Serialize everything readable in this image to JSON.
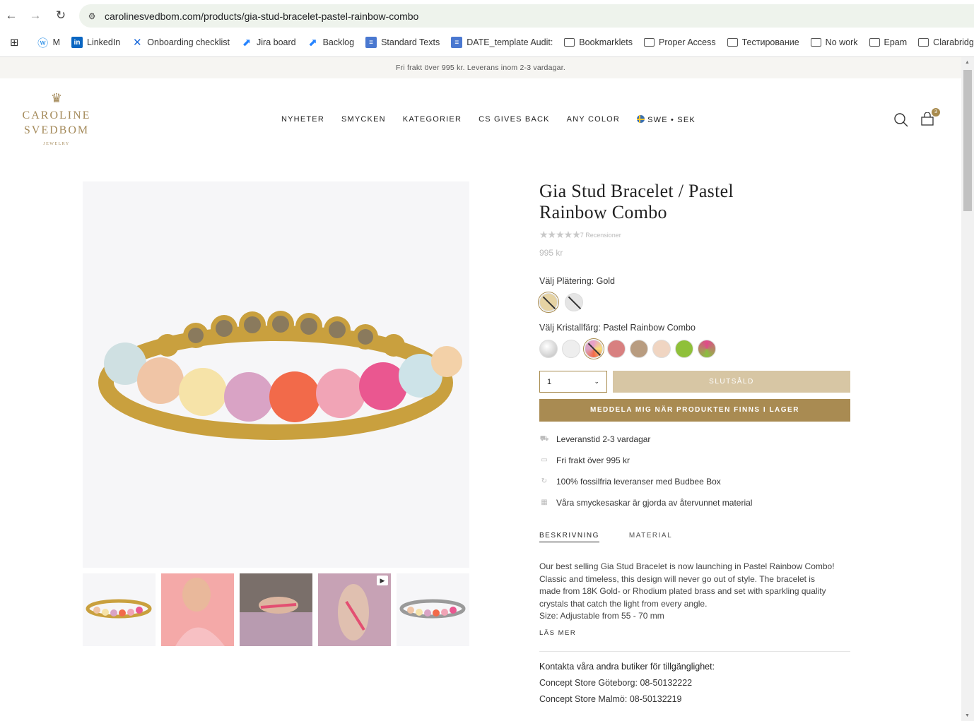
{
  "browser": {
    "url": "carolinesvedbom.com/products/gia-stud-bracelet-pastel-rainbow-combo",
    "bookmarks": [
      {
        "label": "M",
        "icon": "wordpress-icon"
      },
      {
        "label": "LinkedIn",
        "icon": "linkedin-icon"
      },
      {
        "label": "Onboarding checklist",
        "icon": "confluence-icon"
      },
      {
        "label": "Jira board",
        "icon": "jira-icon"
      },
      {
        "label": "Backlog",
        "icon": "jira-icon"
      },
      {
        "label": "Standard Texts",
        "icon": "docs-icon"
      },
      {
        "label": "DATE_template Audit:",
        "icon": "docs-icon"
      },
      {
        "label": "Bookmarklets",
        "icon": "folder-icon"
      },
      {
        "label": "Proper Access",
        "icon": "folder-icon"
      },
      {
        "label": "Тестирование",
        "icon": "folder-icon"
      },
      {
        "label": "No work",
        "icon": "folder-icon"
      },
      {
        "label": "Epam",
        "icon": "folder-icon"
      },
      {
        "label": "Clarabridge",
        "icon": "folder-icon"
      }
    ]
  },
  "site": {
    "announcement": "Fri frakt över 995 kr. Leverans inom 2-3 vardagar.",
    "logo": {
      "name_line1": "CAROLINE",
      "name_line2": "SVEDBOM",
      "tagline": "JEWELRY"
    },
    "nav": [
      "NYHETER",
      "SMYCKEN",
      "KATEGORIER",
      "CS GIVES BACK",
      "ANY COLOR"
    ],
    "locale": "SWE • SEK",
    "cart_count": "3",
    "accent_color": "#a98b52"
  },
  "product": {
    "title": "Gia Stud Bracelet / Pastel Rainbow Combo",
    "stars": "★★★★★",
    "rating_value": 5,
    "reviews": "7 Recensioner",
    "price": "995 kr",
    "plating_label": "Välj Plätering:",
    "plating_value": "Gold",
    "crystal_label": "Välj Kristallfärg:",
    "crystal_value": "Pastel Rainbow Combo",
    "qty": "1",
    "soldout_label": "SLUTSÅLD",
    "notify_label": "MEDDELA MIG NÄR PRODUKTEN FINNS I LAGER",
    "usps": [
      {
        "icon": "truck-icon",
        "text": "Leveranstid 2-3 vardagar"
      },
      {
        "icon": "box-icon",
        "text": "Fri frakt över 995 kr"
      },
      {
        "icon": "recycle-icon",
        "text": "100% fossilfria leveranser med Budbee Box"
      },
      {
        "icon": "gift-icon",
        "text": "Våra smyckesaskar är gjorda av återvunnet material"
      }
    ],
    "tabs": [
      "BESKRIVNING",
      "MATERIAL"
    ],
    "description": [
      "Our best selling Gia Stud Bracelet is now launching in Pastel Rainbow Combo!",
      "Classic and timeless, this design will never go out of style. The bracelet is",
      "made from 18K Gold- or Rhodium plated brass and set with sparkling quality",
      "crystals that catch the light from every angle.",
      "Size: Adjustable from 55 - 70 mm"
    ],
    "read_more": "LÄS MER",
    "contact_heading": "Kontakta våra andra butiker för tillgänglighet:",
    "contacts": [
      "Concept Store Göteborg: 08-50132222",
      "Concept Store Malmö: 08-50132219"
    ]
  }
}
